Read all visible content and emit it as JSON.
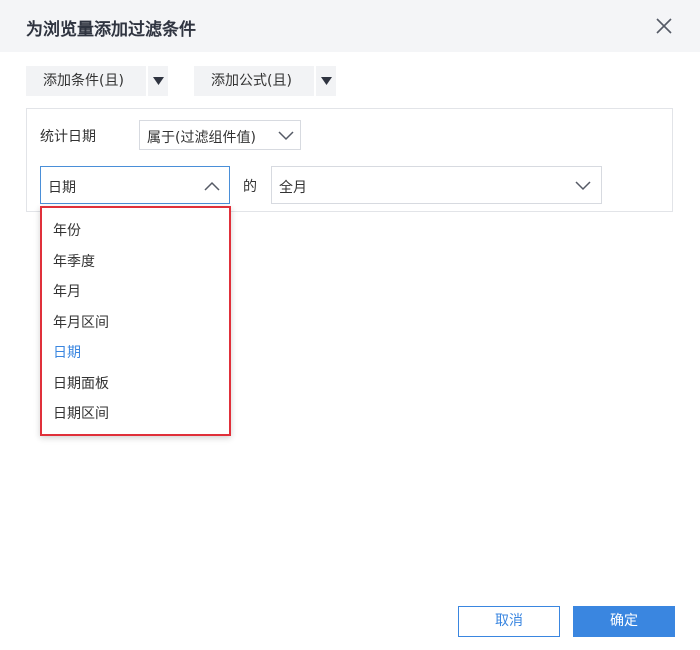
{
  "dialog": {
    "title": "为浏览量添加过滤条件"
  },
  "toolbar": {
    "add_condition_label": "添加条件(且)",
    "add_formula_label": "添加公式(且)"
  },
  "condition": {
    "field_label": "统计日期",
    "operator_value": "属于(过滤组件值)",
    "date_type_value": "日期",
    "connector_label": "的",
    "range_value": "全月"
  },
  "dropdown": {
    "items": [
      {
        "label": "年份"
      },
      {
        "label": "年季度"
      },
      {
        "label": "年月"
      },
      {
        "label": "年月区间"
      },
      {
        "label": "日期"
      },
      {
        "label": "日期面板"
      },
      {
        "label": "日期区间"
      }
    ],
    "selected_index": 4
  },
  "footer": {
    "cancel_label": "取消",
    "ok_label": "确定"
  },
  "colors": {
    "accent": "#3a86e0",
    "highlight_border": "#e0303a",
    "header_bg": "#f4f5f7"
  }
}
